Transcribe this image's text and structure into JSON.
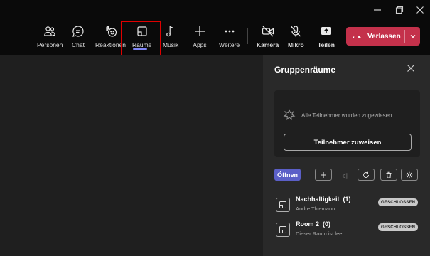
{
  "toolbar": {
    "items": [
      {
        "label": "Personen",
        "icon": "people-icon"
      },
      {
        "label": "Chat",
        "icon": "chat-icon"
      },
      {
        "label": "Reaktionen",
        "icon": "reactions-icon"
      },
      {
        "label": "Räume",
        "icon": "rooms-icon"
      },
      {
        "label": "Musik",
        "icon": "music-icon"
      },
      {
        "label": "Apps",
        "icon": "plus-icon"
      },
      {
        "label": "Weitere",
        "icon": "more-icon"
      },
      {
        "label": "Kamera",
        "icon": "camera-off-icon"
      },
      {
        "label": "Mikro",
        "icon": "mic-off-icon"
      },
      {
        "label": "Teilen",
        "icon": "share-icon"
      }
    ],
    "active": "Räume",
    "leave_label": "Verlassen"
  },
  "panel": {
    "title": "Gruppenräume",
    "empty_message": "Alle Teilnehmer wurden zugewiesen",
    "assign_button": "Teilnehmer zuweisen",
    "open_button": "Öffnen",
    "rooms": [
      {
        "name": "Nachhaltigkeit",
        "count": "(1)",
        "subtitle": "Andre Thiemann",
        "status": "GESCHLOSSEN"
      },
      {
        "name": "Room 2",
        "count": "(0)",
        "subtitle": "Dieser Raum ist leer",
        "status": "GESCHLOSSEN"
      }
    ]
  },
  "colors": {
    "accent": "#5b5fc7",
    "leave": "#c4314b",
    "highlight": "#e00000"
  }
}
